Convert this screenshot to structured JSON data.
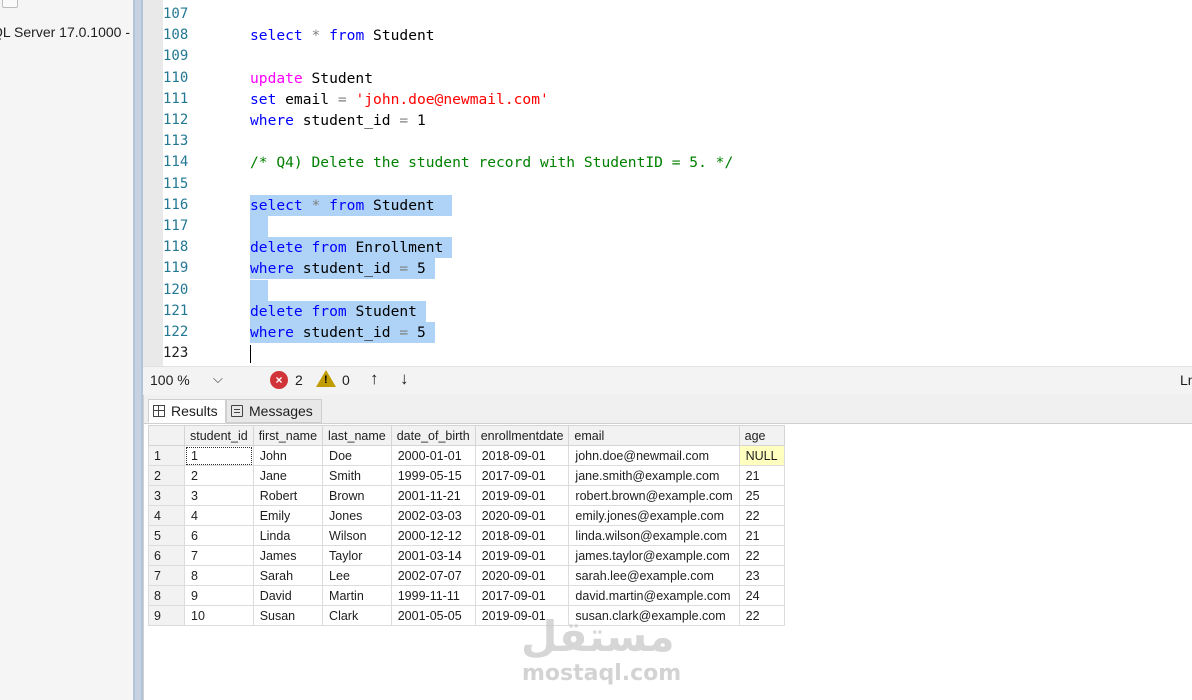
{
  "object_explorer": {
    "server_node": "QL Server 17.0.1000 -"
  },
  "editor": {
    "lines": [
      {
        "num": "107",
        "tokens": []
      },
      {
        "num": "108",
        "tokens": [
          {
            "t": "select",
            "c": "kw"
          },
          {
            "t": " ",
            "c": "id"
          },
          {
            "t": "*",
            "c": "op"
          },
          {
            "t": " ",
            "c": "id"
          },
          {
            "t": "from",
            "c": "kw"
          },
          {
            "t": " Student",
            "c": "id"
          }
        ]
      },
      {
        "num": "109",
        "tokens": []
      },
      {
        "num": "110",
        "tokens": [
          {
            "t": "update",
            "c": "kw2"
          },
          {
            "t": " Student",
            "c": "id"
          }
        ]
      },
      {
        "num": "111",
        "tokens": [
          {
            "t": "set",
            "c": "kw"
          },
          {
            "t": " email ",
            "c": "id"
          },
          {
            "t": "=",
            "c": "op"
          },
          {
            "t": " ",
            "c": "id"
          },
          {
            "t": "'john.doe@newmail.com'",
            "c": "str"
          }
        ]
      },
      {
        "num": "112",
        "tokens": [
          {
            "t": "where",
            "c": "kw"
          },
          {
            "t": " student_id ",
            "c": "id"
          },
          {
            "t": "=",
            "c": "op"
          },
          {
            "t": " 1",
            "c": "id"
          }
        ]
      },
      {
        "num": "113",
        "tokens": []
      },
      {
        "num": "114",
        "tokens": [
          {
            "t": "/* Q4) Delete the student record with StudentID = 5. */",
            "c": "cmt"
          }
        ]
      },
      {
        "num": "115",
        "tokens": []
      },
      {
        "num": "116",
        "hl": true,
        "tokens": [
          {
            "t": "select",
            "c": "kw"
          },
          {
            "t": " ",
            "c": "id"
          },
          {
            "t": "*",
            "c": "op"
          },
          {
            "t": " ",
            "c": "id"
          },
          {
            "t": "from",
            "c": "kw"
          },
          {
            "t": " Student  ",
            "c": "id"
          }
        ]
      },
      {
        "num": "117",
        "hl": true,
        "tokens": [
          {
            "t": "  ",
            "c": "id"
          }
        ]
      },
      {
        "num": "118",
        "hl": true,
        "tokens": [
          {
            "t": "delete",
            "c": "kw"
          },
          {
            "t": " ",
            "c": "id"
          },
          {
            "t": "from",
            "c": "kw"
          },
          {
            "t": " Enrollment ",
            "c": "id"
          }
        ]
      },
      {
        "num": "119",
        "hl": true,
        "tokens": [
          {
            "t": "where",
            "c": "kw"
          },
          {
            "t": " student_id ",
            "c": "id"
          },
          {
            "t": "=",
            "c": "op"
          },
          {
            "t": " 5 ",
            "c": "id"
          }
        ]
      },
      {
        "num": "120",
        "hl": true,
        "tokens": [
          {
            "t": "  ",
            "c": "id"
          }
        ]
      },
      {
        "num": "121",
        "hl": true,
        "tokens": [
          {
            "t": "delete",
            "c": "kw"
          },
          {
            "t": " ",
            "c": "id"
          },
          {
            "t": "from",
            "c": "kw"
          },
          {
            "t": " Student ",
            "c": "id"
          }
        ]
      },
      {
        "num": "122",
        "hl": true,
        "tokens": [
          {
            "t": "where",
            "c": "kw"
          },
          {
            "t": " student_id ",
            "c": "id"
          },
          {
            "t": "=",
            "c": "op"
          },
          {
            "t": " 5 ",
            "c": "id"
          }
        ]
      },
      {
        "num": "123",
        "current": true,
        "tokens": []
      }
    ]
  },
  "toolbar": {
    "zoom": "100 %",
    "error_count": "2",
    "warning_count": "0",
    "ln_label": "Ln",
    "error_mark": "×",
    "warning_mark": "!",
    "up_arrow": "↑",
    "down_arrow": "↓",
    "zoom_chevron": "⌵"
  },
  "results": {
    "tabs": [
      {
        "label": "Results"
      },
      {
        "label": "Messages"
      }
    ],
    "columns": [
      "",
      "student_id",
      "first_name",
      "last_name",
      "date_of_birth",
      "enrollmentdate",
      "email",
      "age"
    ],
    "rows": [
      [
        "1",
        "1",
        "John",
        "Doe",
        "2000-01-01",
        "2018-09-01",
        "john.doe@newmail.com",
        "NULL"
      ],
      [
        "2",
        "2",
        "Jane",
        "Smith",
        "1999-05-15",
        "2017-09-01",
        "jane.smith@example.com",
        "21"
      ],
      [
        "3",
        "3",
        "Robert",
        "Brown",
        "2001-11-21",
        "2019-09-01",
        "robert.brown@example.com",
        "25"
      ],
      [
        "4",
        "4",
        "Emily",
        "Jones",
        "2002-03-03",
        "2020-09-01",
        "emily.jones@example.com",
        "22"
      ],
      [
        "5",
        "6",
        "Linda",
        "Wilson",
        "2000-12-12",
        "2018-09-01",
        "linda.wilson@example.com",
        "21"
      ],
      [
        "6",
        "7",
        "James",
        "Taylor",
        "2001-03-14",
        "2019-09-01",
        "james.taylor@example.com",
        "22"
      ],
      [
        "7",
        "8",
        "Sarah",
        "Lee",
        "2002-07-07",
        "2020-09-01",
        "sarah.lee@example.com",
        "23"
      ],
      [
        "8",
        "9",
        "David",
        "Martin",
        "1999-11-11",
        "2017-09-01",
        "david.martin@example.com",
        "24"
      ],
      [
        "9",
        "10",
        "Susan",
        "Clark",
        "2001-05-05",
        "2019-09-01",
        "susan.clark@example.com",
        "22"
      ]
    ]
  },
  "watermark": {
    "arabic": "مستقل",
    "latin": "mostaql.com"
  },
  "colors": {
    "selection": "#aed3f7",
    "keyword": "#0000ff",
    "keyword_dml": "#ff00ff",
    "string": "#ff0000",
    "comment": "#008000",
    "null_cell": "#ffffc0"
  }
}
